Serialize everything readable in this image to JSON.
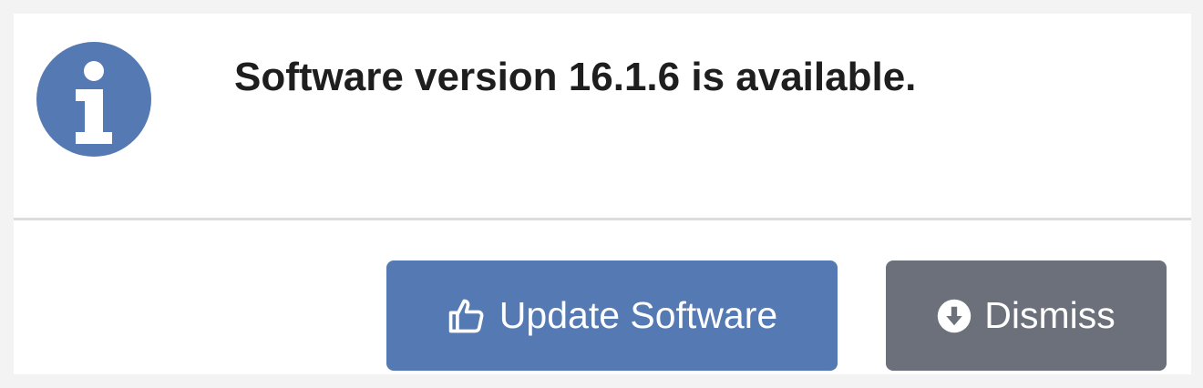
{
  "notification": {
    "icon": "info-circle-icon",
    "message": "Software version 16.1.6 is available.",
    "icon_color": "#5479b3"
  },
  "actions": {
    "update": {
      "label": "Update Software",
      "icon": "thumbs-up-icon",
      "color": "#5479b3"
    },
    "dismiss": {
      "label": "Dismiss",
      "icon": "arrow-circle-down-icon",
      "color": "#6c707a"
    }
  }
}
